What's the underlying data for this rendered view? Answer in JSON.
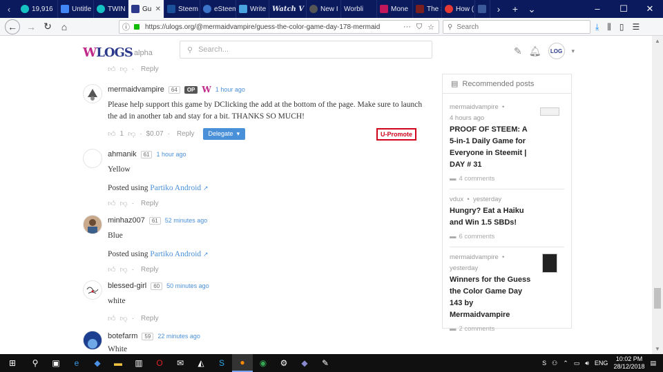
{
  "browser": {
    "tabs": [
      {
        "label": "19,916",
        "color": "#16c3c3"
      },
      {
        "label": "Untitle",
        "color": "#4285f4"
      },
      {
        "label": "TWIN",
        "color": "#16c3c3"
      },
      {
        "label": "Gu",
        "color": "#2d3a8c",
        "active": true
      },
      {
        "label": "Steem",
        "color": "#1a5099"
      },
      {
        "label": "eSteem",
        "color": "#3b73c8"
      },
      {
        "label": "Write",
        "color": "#4aa3df"
      },
      {
        "label": "Watch V",
        "color": "#222222"
      },
      {
        "label": "New I",
        "color": "#555555"
      },
      {
        "label": "Worbli",
        "color": "#333333"
      },
      {
        "label": "Mone",
        "color": "#c2185b"
      },
      {
        "label": "The S",
        "color": "#7a1f1f"
      },
      {
        "label": "How (",
        "color": "#e53935"
      },
      {
        "label": "",
        "color": "#3b5998"
      }
    ],
    "url": "https://ulogs.org/@mermaidvampire/guess-the-color-game-day-178-mermaid",
    "search_placeholder": "Search"
  },
  "site": {
    "logo_text": "ULOGS",
    "logo_suffix": "alpha",
    "search_placeholder": "Search..."
  },
  "top_actions": {
    "reply": "Reply"
  },
  "comments": [
    {
      "author": "mermaidvampire",
      "rep": "64",
      "op": "OP",
      "time": "1 hour ago",
      "text": "Please help support this game by DClicking the add at the bottom of the page. Make sure to launch the ad in another tab and stay for a bit. THANKS SO MUCH!",
      "votes": "1",
      "payout": "$0.07",
      "reply": "Reply",
      "delegate": "Delegate",
      "promote": "U-Promote"
    },
    {
      "author": "ahmanik",
      "rep": "61",
      "time": "1 hour ago",
      "text": "Yellow",
      "posted_prefix": "Posted using",
      "posted_app": "Partiko Android",
      "reply": "Reply"
    },
    {
      "author": "minhaz007",
      "rep": "61",
      "time": "52 minutes ago",
      "text": "Blue",
      "posted_prefix": "Posted using",
      "posted_app": "Partiko Android",
      "reply": "Reply"
    },
    {
      "author": "blessed-girl",
      "rep": "60",
      "time": "50 minutes ago",
      "text": "white",
      "reply": "Reply"
    },
    {
      "author": "botefarm",
      "rep": "59",
      "time": "22 minutes ago",
      "text": "White"
    }
  ],
  "sidebar": {
    "heading": "Recommended posts",
    "posts": [
      {
        "author": "mermaidvampire",
        "time": "4 hours ago",
        "title": "PROOF OF STEEM: A 5-in-1 Daily Game for Everyone in Steemit | DAY # 31",
        "comments": "4 comments"
      },
      {
        "author": "vdux",
        "time": "yesterday",
        "title": "Hungry? Eat a Haiku and Win 1.5 SBDs!",
        "comments": "6 comments"
      },
      {
        "author": "mermaidvampire",
        "time": "yesterday",
        "title": "Winners for the Guess the Color Game Day 143 by Mermaidvampire",
        "comments": "2 comments"
      }
    ]
  },
  "taskbar": {
    "lang": "ENG",
    "time": "10:02 PM",
    "date": "28/12/2018"
  },
  "icons": {
    "back": "back-arrow-icon",
    "forward": "forward-arrow-icon",
    "reload": "reload-icon",
    "home": "home-icon",
    "upvote": "thumbs-up-icon",
    "downvote": "thumbs-down-icon"
  }
}
